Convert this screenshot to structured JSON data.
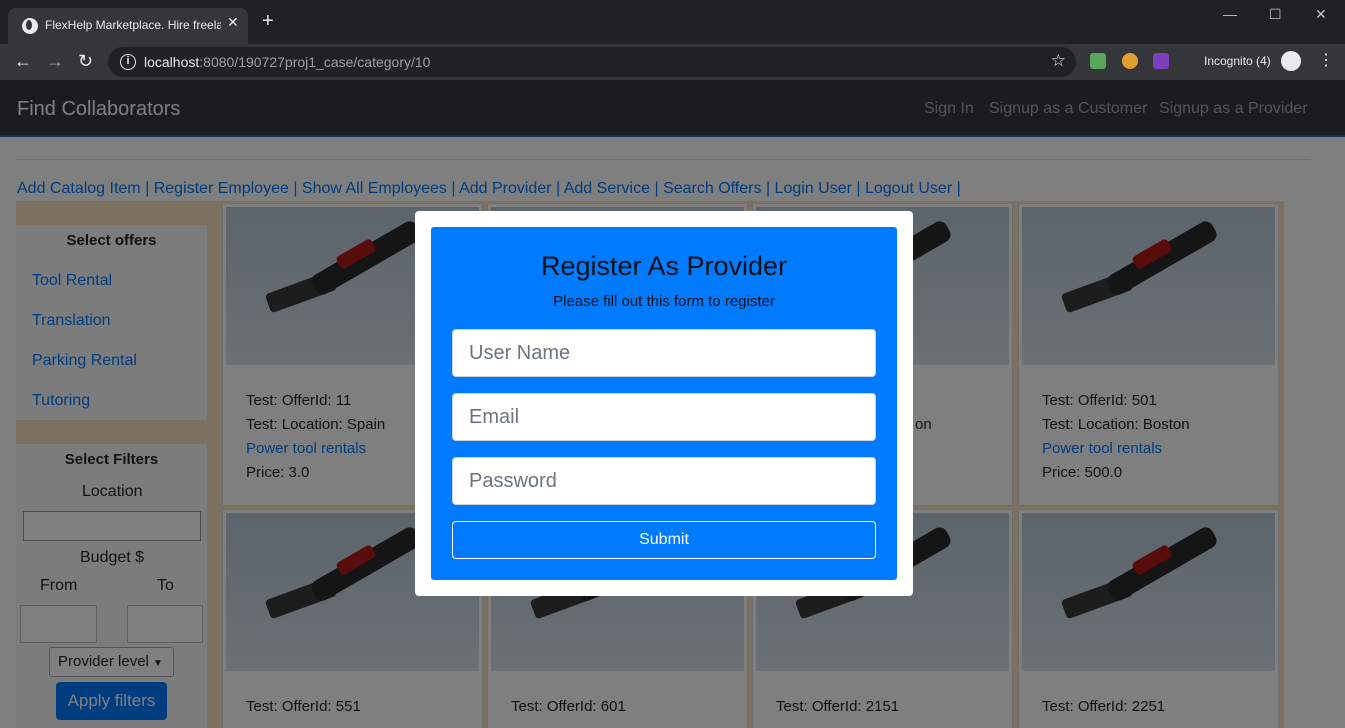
{
  "browser": {
    "tab_title": "FlexHelp Marketplace. Hire freela",
    "url_host": "localhost",
    "url_rest": ":8080/190727proj1_case/category/10",
    "incognito_label": "Incognito (4)"
  },
  "navbar": {
    "brand": "Find Collaborators",
    "links": [
      "Sign In",
      "Signup as a Customer",
      "Signup as a Provider"
    ]
  },
  "admin_links": [
    "Add Catalog Item",
    "Register Employee",
    "Show All Employees",
    "Add Provider",
    "Add Service",
    "Search Offers",
    "Login User",
    "Logout User"
  ],
  "sidebar": {
    "offers_heading": "Select offers",
    "offers": [
      "Tool Rental",
      "Translation",
      "Parking Rental",
      "Tutoring"
    ],
    "filters_heading": "Select Filters",
    "location_label": "Location",
    "budget_label": "Budget $",
    "from_label": "From",
    "to_label": "To",
    "provider_level": "Provider level",
    "apply_label": "Apply filters"
  },
  "cards": [
    {
      "offer_id": "Test: OfferId: 11",
      "location": "Test: Location: Spain",
      "link": "Power tool rentals",
      "price": "Price: 3.0"
    },
    {
      "offer_id": "",
      "location": "",
      "link": "",
      "price": ""
    },
    {
      "offer_id": "",
      "location": "on",
      "link": "",
      "price": ""
    },
    {
      "offer_id": "Test: OfferId: 501",
      "location": "Test: Location: Boston",
      "link": "Power tool rentals",
      "price": "Price: 500.0"
    },
    {
      "offer_id": "Test: OfferId: 551",
      "location": "",
      "link": "",
      "price": ""
    },
    {
      "offer_id": "Test: OfferId: 601",
      "location": "",
      "link": "",
      "price": ""
    },
    {
      "offer_id": "Test: OfferId: 2151",
      "location": "",
      "link": "",
      "price": ""
    },
    {
      "offer_id": "Test: OfferId: 2251",
      "location": "",
      "link": "",
      "price": ""
    }
  ],
  "modal": {
    "title": "Register As Provider",
    "subtitle": "Please fill out this form to register",
    "username_placeholder": "User Name",
    "email_placeholder": "Email",
    "password_placeholder": "Password",
    "submit_label": "Submit"
  }
}
